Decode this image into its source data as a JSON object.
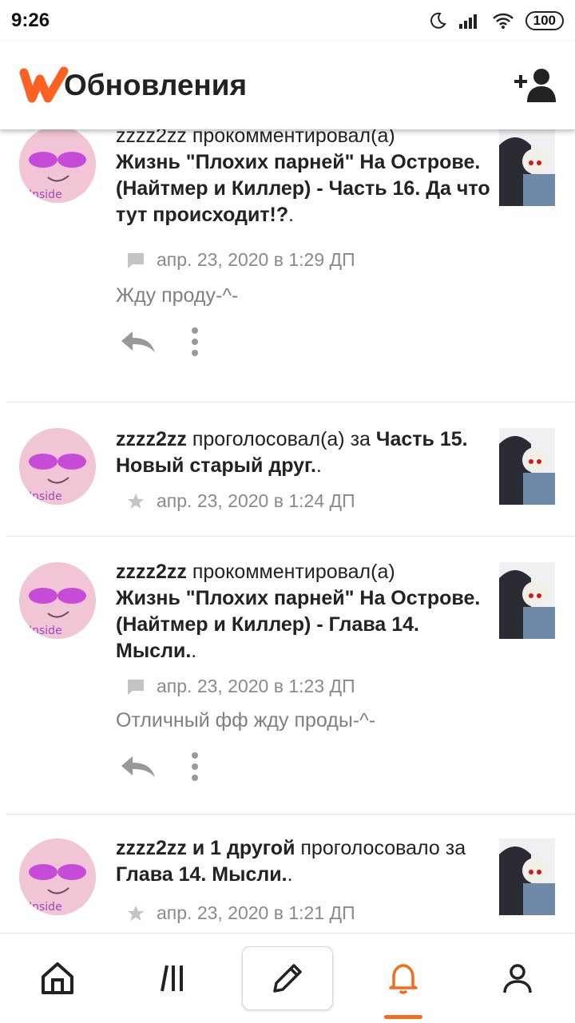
{
  "status": {
    "time": "9:26",
    "battery": "100"
  },
  "header": {
    "title": "Обновления"
  },
  "colors": {
    "brand": "#ff6122",
    "accent": "#f56b1f",
    "meta_gray": "#8a8a8a"
  },
  "feed": [
    {
      "user": "zzzz2zz",
      "action": " прокомментировал(а)",
      "story": "Жизнь \"Плохих парней\" На Острове. (Найтмер и Киллер) - Часть 16. Да что тут происходит!?",
      "story_suffix": ".",
      "meta_icon": "comment-icon",
      "time": "апр. 23, 2020 в 1:29 ДП",
      "comment": "Жду проду-^-"
    },
    {
      "user": "zzzz2zz",
      "action": " проголосовал(а) за ",
      "story": "Часть 15. Новый старый друг.",
      "story_suffix": ".",
      "meta_icon": "star-icon",
      "time": "апр. 23, 2020 в 1:24 ДП"
    },
    {
      "user": "zzzz2zz",
      "action": " прокомментировал(а)",
      "story": "Жизнь \"Плохих парней\" На Острове. (Найтмер и Киллер) - Глава 14. Мысли.",
      "story_suffix": ".",
      "meta_icon": "comment-icon",
      "time": "апр. 23, 2020 в 1:23 ДП",
      "comment": "Отличный фф жду проды-^-"
    },
    {
      "user": "zzzz2zz и 1 другой",
      "action": " проголосовало за ",
      "story": "Глава 14. Мысли.",
      "story_suffix": ".",
      "meta_icon": "star-icon",
      "time": "апр. 23, 2020 в 1:21 ДП"
    }
  ],
  "nav": [
    {
      "name": "home",
      "icon": "home-icon"
    },
    {
      "name": "library",
      "icon": "library-icon"
    },
    {
      "name": "write",
      "icon": "pencil-icon"
    },
    {
      "name": "notifications",
      "icon": "bell-icon",
      "active": true
    },
    {
      "name": "profile",
      "icon": "profile-icon"
    }
  ]
}
